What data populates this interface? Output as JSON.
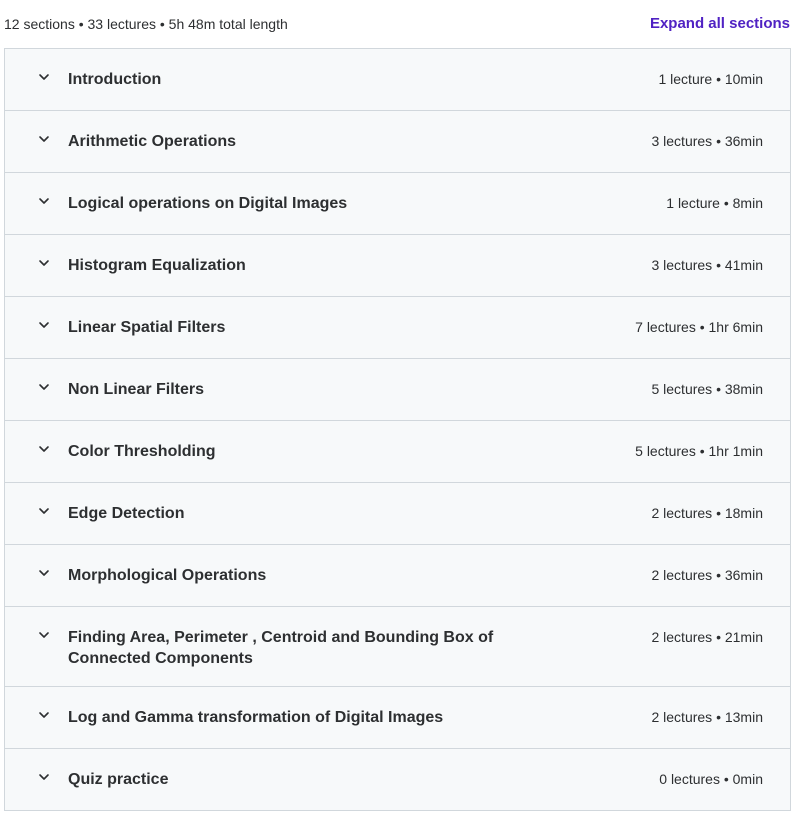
{
  "summary": {
    "text": "12 sections • 33 lectures • 5h 48m total length",
    "expand_label": "Expand all sections"
  },
  "sections": [
    {
      "title": "Introduction",
      "meta": "1 lecture • 10min"
    },
    {
      "title": "Arithmetic Operations",
      "meta": "3 lectures • 36min"
    },
    {
      "title": "Logical operations on Digital Images",
      "meta": "1 lecture • 8min"
    },
    {
      "title": "Histogram Equalization",
      "meta": "3 lectures • 41min"
    },
    {
      "title": "Linear Spatial Filters",
      "meta": "7 lectures • 1hr 6min"
    },
    {
      "title": "Non Linear Filters",
      "meta": "5 lectures • 38min"
    },
    {
      "title": "Color Thresholding",
      "meta": "5 lectures • 1hr 1min"
    },
    {
      "title": "Edge Detection",
      "meta": "2 lectures • 18min"
    },
    {
      "title": "Morphological Operations",
      "meta": "2 lectures • 36min"
    },
    {
      "title": "Finding Area, Perimeter , Centroid and Bounding Box of Connected Components",
      "meta": "2 lectures • 21min"
    },
    {
      "title": "Log and Gamma transformation of Digital Images",
      "meta": "2 lectures • 13min"
    },
    {
      "title": "Quiz practice",
      "meta": "0 lectures • 0min"
    }
  ],
  "icons": {
    "chevron": "chevron-down-icon"
  },
  "colors": {
    "accent": "#5022c3",
    "section_bg": "#f7f9fa",
    "border": "#d1d7dc",
    "text": "#2d2f31"
  }
}
